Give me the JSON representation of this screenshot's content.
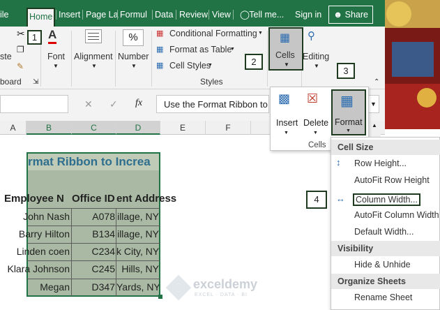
{
  "tabs": {
    "file": "ile",
    "home": "Home",
    "insert": "Insert",
    "page_layout": "Page La",
    "formulas": "Formul",
    "data": "Data",
    "review": "Review",
    "view": "View",
    "tell_me": "Tell me...",
    "sign_in": "Sign in",
    "share": "Share"
  },
  "ribbon": {
    "paste": "ste",
    "clipboard": "board",
    "font": "Font",
    "alignment": "Alignment",
    "number": "Number",
    "percent": "%",
    "conditional_formatting": "Conditional Formatting",
    "format_as_table": "Format as Table",
    "cell_styles": "Cell Styles",
    "styles": "Styles",
    "cells": "Cells",
    "editing": "Editing"
  },
  "callouts": [
    "1",
    "2",
    "3",
    "4"
  ],
  "formula_bar": {
    "cancel": "✕",
    "enter": "✓",
    "fx": "fx",
    "content": "Use the Format Ribbon to"
  },
  "columns": [
    "A",
    "B",
    "C",
    "D",
    "E",
    "F"
  ],
  "sheet": {
    "title": "rmat Ribbon to Increa",
    "headers": [
      "Employee N",
      "Office ID",
      "ent Address"
    ],
    "rows": [
      [
        "John Nash",
        "A078",
        "illage, NY"
      ],
      [
        "Barry Hilton",
        "B134",
        "illage, NY"
      ],
      [
        "Linden coen",
        "C234",
        "k City, NY"
      ],
      [
        "Klara Johnson",
        "C245",
        "Hills, NY"
      ],
      [
        "Megan",
        "D347",
        "Yards, NY"
      ]
    ]
  },
  "cells_dropdown": {
    "insert": "Insert",
    "delete": "Delete",
    "format": "Format",
    "group": "Cells"
  },
  "format_menu": {
    "cell_size": "Cell Size",
    "row_height": "Row Height...",
    "autofit_row": "AutoFit Row Height",
    "column_width": "Column Width...",
    "autofit_column": "AutoFit Column Width",
    "default_width": "Default Width...",
    "visibility": "Visibility",
    "hide_unhide": "Hide & Unhide",
    "organize": "Organize Sheets",
    "rename": "Rename Sheet"
  },
  "watermark": {
    "name": "exceldemy",
    "tagline": "EXCEL · DATA · BI"
  },
  "colors": {
    "excel_green": "#217346",
    "selection_fill": "#a9b9a3",
    "title_text": "#2e6e8e"
  }
}
